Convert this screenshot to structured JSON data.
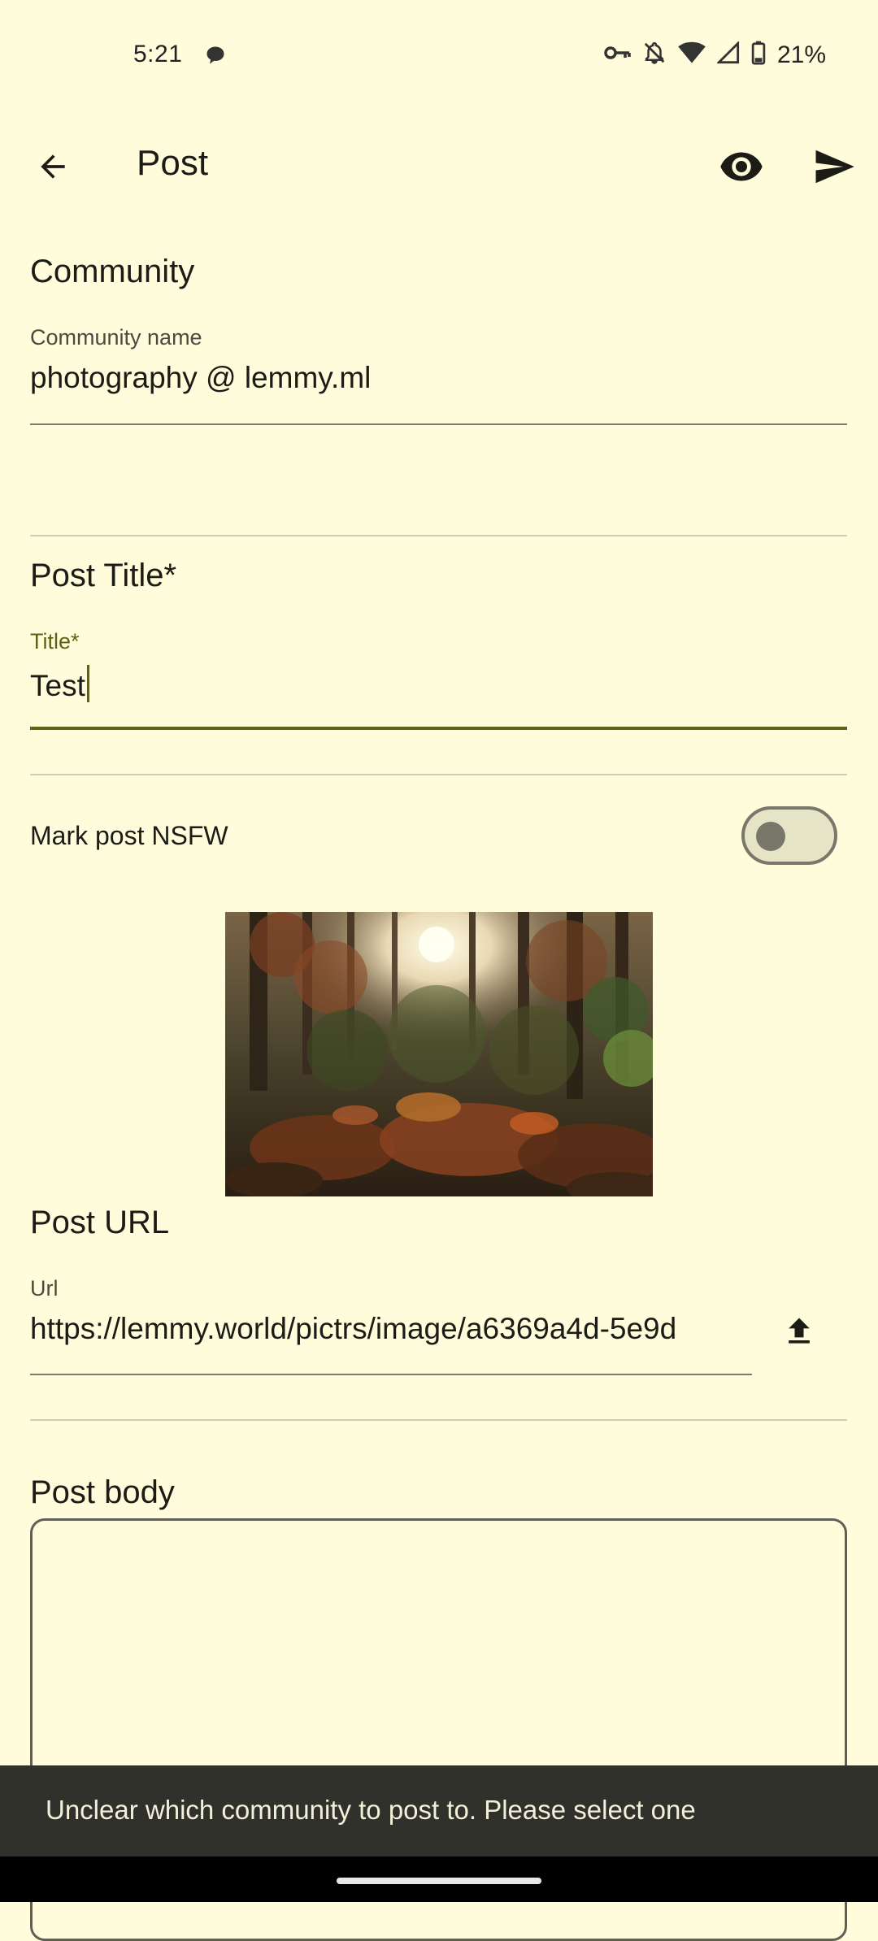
{
  "status_bar": {
    "time": "5:21",
    "battery": "21%",
    "icons": [
      "message-bubble-icon",
      "vpn-key-icon",
      "bell-off-icon",
      "wifi-icon",
      "signal-icon",
      "battery-icon"
    ]
  },
  "app_bar": {
    "title": "Post",
    "back_icon": "arrow-back-icon",
    "preview_icon": "eye-icon",
    "send_icon": "send-icon"
  },
  "community": {
    "section_title": "Community",
    "label": "Community name",
    "value": "photography @ lemmy.ml"
  },
  "post_title": {
    "section_title": "Post Title*",
    "label": "Title*",
    "value": "Test"
  },
  "nsfw": {
    "label": "Mark post NSFW",
    "enabled": false
  },
  "post_url": {
    "section_title": "Post URL",
    "label": "Url",
    "value": "https://lemmy.world/pictrs/image/a6369a4d-5e9d",
    "upload_icon": "upload-icon"
  },
  "post_body": {
    "section_title": "Post body",
    "value": ""
  },
  "snackbar": {
    "message": "Unclear which community to post to. Please select one"
  },
  "colors": {
    "background": "#FFFCDC",
    "accent": "#5E6212",
    "snackbar": "#31312B"
  }
}
